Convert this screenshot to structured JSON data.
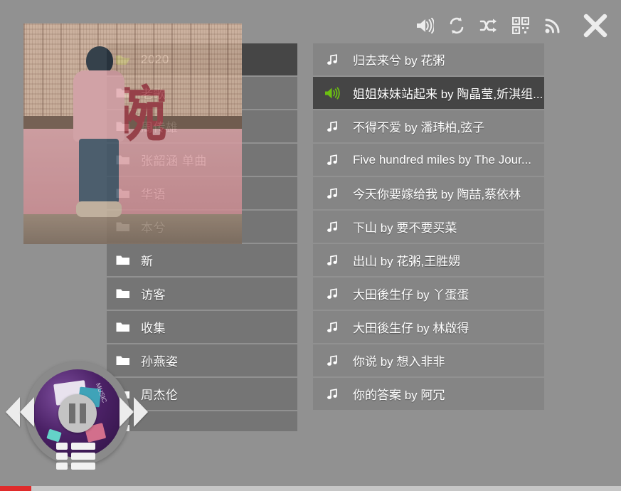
{
  "app": {
    "background_color": "#919191",
    "accent_color": "#6cc011",
    "progress_color": "#e02b2b"
  },
  "toolbar": {
    "items": [
      {
        "name": "volume-icon",
        "label": "Volume"
      },
      {
        "name": "repeat-icon",
        "label": "Repeat"
      },
      {
        "name": "shuffle-icon",
        "label": "Shuffle"
      },
      {
        "name": "qrcode-icon",
        "label": "QR Code"
      },
      {
        "name": "rss-icon",
        "label": "RSS"
      },
      {
        "name": "close-icon",
        "label": "Close"
      }
    ]
  },
  "folders": {
    "items": [
      {
        "label": "2020",
        "icon": "folder-open-icon",
        "selected": true
      },
      {
        "label": "老歌",
        "icon": "folder-icon",
        "selected": false
      },
      {
        "label": "周传雄",
        "icon": "folder-icon",
        "selected": false
      },
      {
        "label": "张韶涵 单曲",
        "icon": "folder-icon",
        "selected": false
      },
      {
        "label": "华语",
        "icon": "folder-icon",
        "selected": false
      },
      {
        "label": "本兮",
        "icon": "folder-icon",
        "selected": false
      },
      {
        "label": "新",
        "icon": "folder-icon",
        "selected": false
      },
      {
        "label": "访客",
        "icon": "folder-icon",
        "selected": false
      },
      {
        "label": "收集",
        "icon": "folder-icon",
        "selected": false
      },
      {
        "label": "孙燕姿",
        "icon": "folder-icon",
        "selected": false
      },
      {
        "label": "周杰伦",
        "icon": "folder-icon",
        "selected": false
      },
      {
        "label": "",
        "icon": "folder-icon",
        "selected": false
      }
    ]
  },
  "album_art": {
    "big_character": "碗"
  },
  "playlist": {
    "tracks": [
      {
        "title": "归去来兮 by 花粥",
        "icon": "music-note-icon",
        "playing": false
      },
      {
        "title": "姐姐妹妹站起来 by 陶晶莹,妡淇组...",
        "icon": "speaker-playing-icon",
        "playing": true
      },
      {
        "title": "不得不爱 by 潘玮柏,弦子",
        "icon": "music-note-icon",
        "playing": false
      },
      {
        "title": "Five hundred miles by The Jour...",
        "icon": "music-note-icon",
        "playing": false
      },
      {
        "title": "今天你要嫁给我 by 陶喆,蔡依林",
        "icon": "music-note-icon",
        "playing": false
      },
      {
        "title": "下山 by 要不要买菜",
        "icon": "music-note-icon",
        "playing": false
      },
      {
        "title": "出山 by 花粥,王胜娚",
        "icon": "music-note-icon",
        "playing": false
      },
      {
        "title": "大田後生仔 by 丫蛋蛋",
        "icon": "music-note-icon",
        "playing": false
      },
      {
        "title": "大田後生仔 by 林啟得",
        "icon": "music-note-icon",
        "playing": false
      },
      {
        "title": "你说 by 想入非非",
        "icon": "music-note-icon",
        "playing": false
      },
      {
        "title": "你的答案 by 阿冗",
        "icon": "music-note-icon",
        "playing": false
      }
    ]
  },
  "player": {
    "state_label": "Pause",
    "prev_label": "Previous",
    "next_label": "Next",
    "list_label": "Playlist",
    "disc_side_text": "MUSIC",
    "progress_percent": 5
  }
}
